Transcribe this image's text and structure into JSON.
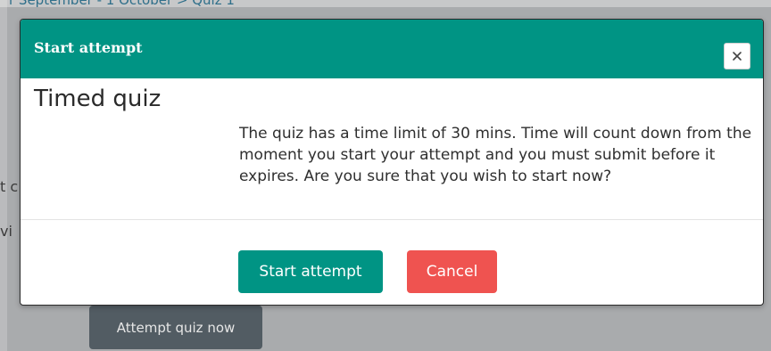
{
  "background_page": {
    "breadcrumb": "r September - 1 October  >  Quiz 1",
    "peek_text_1": "t c",
    "peek_text_2": "vi",
    "attempt_quiz_now_label": "Attempt quiz now"
  },
  "modal": {
    "title": "Start attempt",
    "close_icon": "close-icon",
    "heading": "Timed quiz",
    "message": "The quiz has a time limit of 30 mins. Time will count down from the moment you start your attempt and you must submit before it expires. Are you sure that you wish to start now?",
    "start_button_label": "Start attempt",
    "cancel_button_label": "Cancel"
  },
  "colors": {
    "header": "#009484",
    "start_button": "#009484",
    "cancel_button": "#ef5350",
    "backdrop": "#a9abad"
  }
}
